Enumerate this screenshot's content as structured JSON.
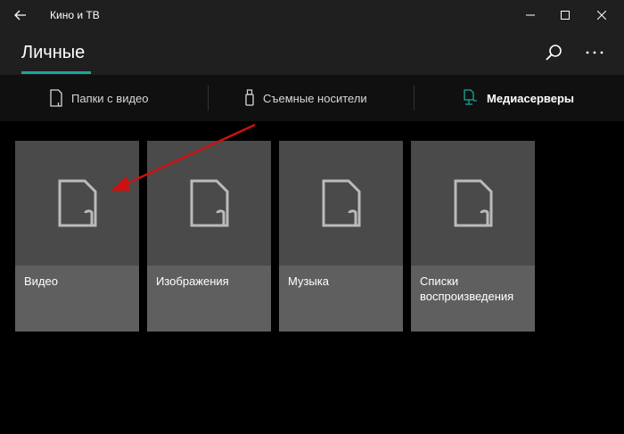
{
  "window": {
    "title": "Кино и ТВ"
  },
  "header": {
    "title": "Личные"
  },
  "subnav": {
    "items": [
      {
        "label": "Папки с видео"
      },
      {
        "label": "Съемные носители"
      },
      {
        "label": "Медиасерверы"
      }
    ]
  },
  "tiles": [
    {
      "label": "Видео"
    },
    {
      "label": "Изображения"
    },
    {
      "label": "Музыка"
    },
    {
      "label": "Списки воспроизведения"
    }
  ],
  "colors": {
    "accent": "#1aa79b",
    "annotation_arrow": "#cc1111"
  },
  "icons": [
    "back-arrow-icon",
    "minimize-icon",
    "maximize-icon",
    "close-icon",
    "search-icon",
    "more-icon",
    "folder-icon",
    "usb-icon",
    "media-server-icon",
    "file-icon"
  ]
}
